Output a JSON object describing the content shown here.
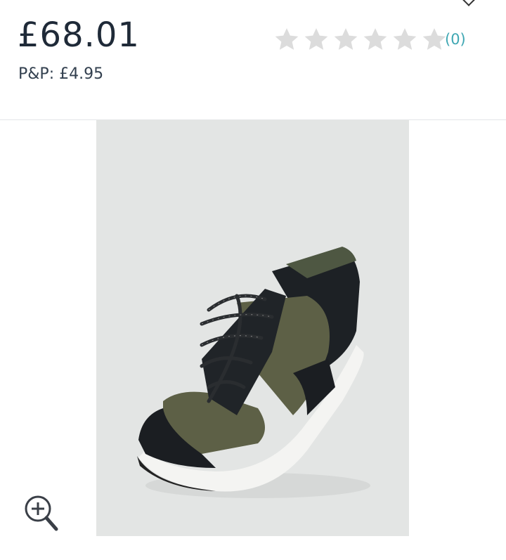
{
  "product": {
    "price": "£68.01",
    "postage": "P&P: £4.95",
    "image_alt": "Khaki and black high top trainer"
  },
  "rating": {
    "stars_filled": 0,
    "stars_total": 6,
    "review_count": "(0)",
    "star_color": "#dcdcdc",
    "link_color": "#3fa7b3"
  },
  "icons": {
    "zoom": "zoom-in-icon",
    "star": "star-icon"
  }
}
